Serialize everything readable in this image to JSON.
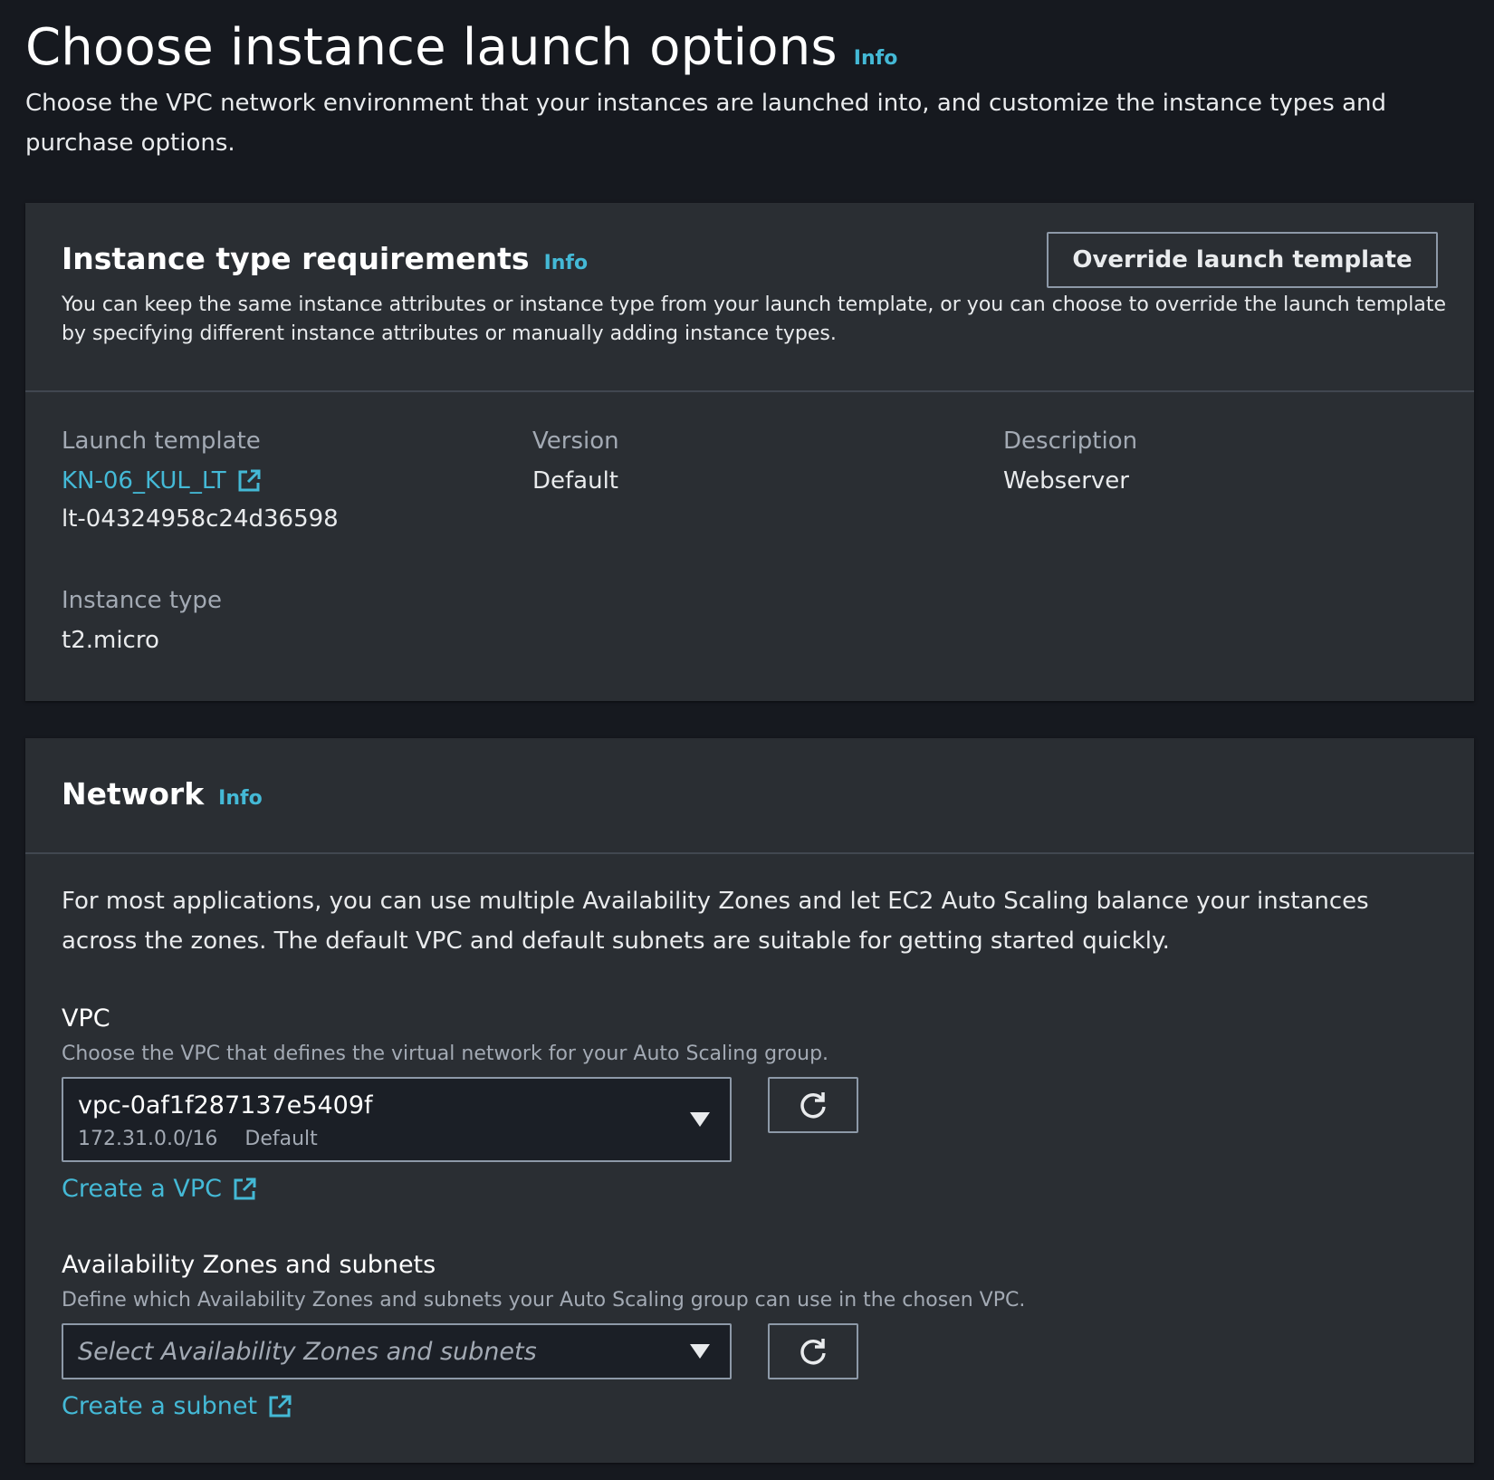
{
  "page": {
    "title": "Choose instance launch options",
    "info": "Info",
    "description": "Choose the VPC network environment that your instances are launched into, and customize the instance types and purchase options."
  },
  "instance_requirements": {
    "title": "Instance type requirements",
    "info": "Info",
    "override_button": "Override launch template",
    "description": "You can keep the same instance attributes or instance type from your launch template, or you can choose to override the launch template by specifying different instance attributes or manually adding instance types.",
    "launch_template": {
      "label": "Launch template",
      "name": "KN-06_KUL_LT",
      "id": "lt-04324958c24d36598"
    },
    "version": {
      "label": "Version",
      "value": "Default"
    },
    "description_field": {
      "label": "Description",
      "value": "Webserver"
    },
    "instance_type": {
      "label": "Instance type",
      "value": "t2.micro"
    }
  },
  "network": {
    "title": "Network",
    "info": "Info",
    "description": "For most applications, you can use multiple Availability Zones and let EC2 Auto Scaling balance your instances across the zones. The default VPC and default subnets are suitable for getting started quickly.",
    "vpc": {
      "label": "VPC",
      "hint": "Choose the VPC that defines the virtual network for your Auto Scaling group.",
      "selected_id": "vpc-0af1f287137e5409f",
      "selected_cidr": "172.31.0.0/16",
      "selected_tag": "Default",
      "create_link": "Create a VPC"
    },
    "az": {
      "label": "Availability Zones and subnets",
      "hint": "Define which Availability Zones and subnets your Auto Scaling group can use in the chosen VPC.",
      "placeholder": "Select Availability Zones and subnets",
      "create_link": "Create a subnet"
    }
  },
  "colors": {
    "background": "#16191f",
    "card": "#2a2e33",
    "link": "#44b9d6",
    "text": "#e9ebed",
    "muted": "#a3aab4",
    "border": "#8d99a8"
  },
  "icons": [
    "external-link-icon",
    "refresh-icon",
    "caret-down-icon"
  ]
}
